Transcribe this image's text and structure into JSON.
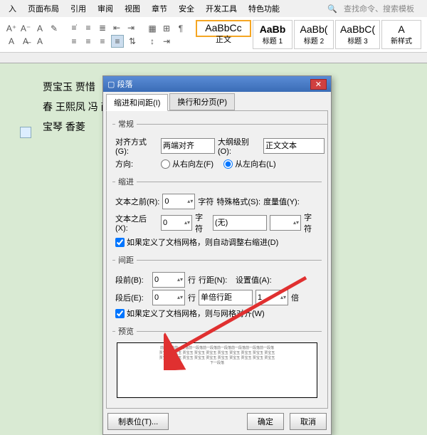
{
  "tabs": {
    "t0": "入",
    "t1": "页面布局",
    "t2": "引用",
    "t3": "审阅",
    "t4": "视图",
    "t5": "章节",
    "t6": "安全",
    "t7": "开发工具",
    "t8": "特色功能",
    "search": "查找命令、搜索模板"
  },
  "styles": {
    "s0p": "AaBbCc",
    "s0n": "正文",
    "s1p": "AaBb",
    "s1n": "标题 1",
    "s2p": "AaBb(",
    "s2n": "标题 2",
    "s3p": "AaBbC(",
    "s3n": "标题 3",
    "more": "新样式"
  },
  "doc": {
    "l1": "贾宝玉                                                                                    贾惜",
    "l2": "春 王熙凤                                                                              冯 薛",
    "l3": "宝琴 香菱"
  },
  "dialog": {
    "title": "段落",
    "tab1": "缩进和间距(I)",
    "tab2": "换行和分页(P)",
    "g1": "常规",
    "align_l": "对齐方式(G):",
    "align_v": "两端对齐",
    "outline_l": "大纲级别(O):",
    "outline_v": "正文文本",
    "dir_l": "方向:",
    "rtl": "从右向左(F)",
    "ltr": "从左向右(L)",
    "g2": "缩进",
    "before_l": "文本之前(R):",
    "before_v": "0",
    "unit_char": "字符",
    "special_l": "特殊格式(S):",
    "special_mv": "度量值(Y):",
    "after_l": "文本之后(X):",
    "after_v": "0",
    "special_v": "(无)",
    "chk1": "如果定义了文档网格，则自动调整右缩进(D)",
    "g3": "间距",
    "sb_l": "段前(B):",
    "sb_v": "0",
    "unit_line": "行",
    "ls_l": "行距(N):",
    "sv_l": "设置值(A):",
    "sa_l": "段后(E):",
    "sa_v": "0",
    "ls_v": "单倍行距",
    "sv_v": "1",
    "unit_bei": "倍",
    "chk2": "如果定义了文档网格，则与网格对齐(W)",
    "g4": "预览",
    "tabbtn": "制表位(T)...",
    "ok": "确定",
    "cancel": "取消"
  }
}
